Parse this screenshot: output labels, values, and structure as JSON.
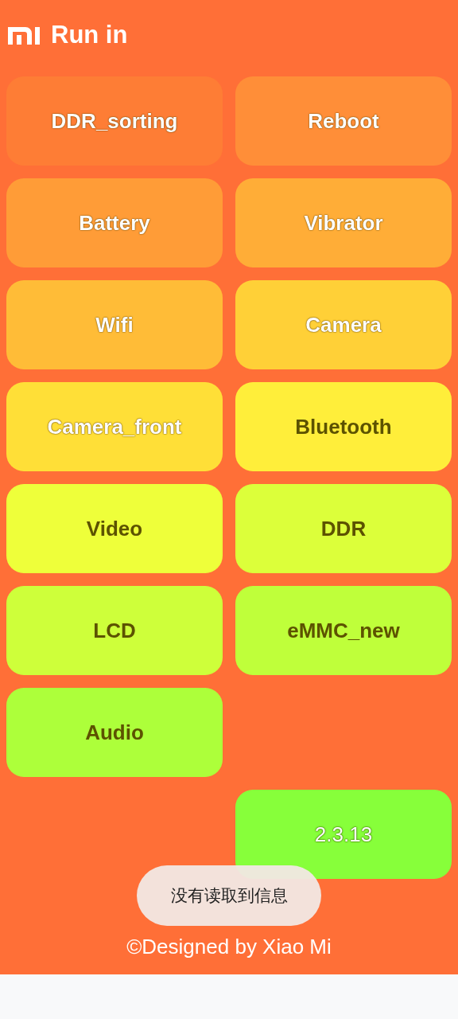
{
  "header": {
    "title": "Run in"
  },
  "buttons": [
    {
      "label": "DDR_sorting",
      "kind": "test",
      "color": "#fe7d35"
    },
    {
      "label": "Reboot",
      "kind": "test",
      "color": "#ff8e38"
    },
    {
      "label": "Battery",
      "kind": "test",
      "color": "#ff9c37"
    },
    {
      "label": "Vibrator",
      "kind": "test",
      "color": "#ffad37"
    },
    {
      "label": "Wifi",
      "kind": "test",
      "color": "#ffbc37"
    },
    {
      "label": "Camera",
      "kind": "test",
      "color": "#ffd037"
    },
    {
      "label": "Camera_front",
      "kind": "test",
      "color": "#ffdf37"
    },
    {
      "label": "Bluetooth",
      "kind": "test",
      "color": "#ffee3a"
    },
    {
      "label": "Video",
      "kind": "test",
      "color": "#eeff3a"
    },
    {
      "label": "DDR",
      "kind": "test",
      "color": "#dcff3a"
    },
    {
      "label": "LCD",
      "kind": "test",
      "color": "#ceff3a"
    },
    {
      "label": "eMMC_new",
      "kind": "test",
      "color": "#bfff3a"
    },
    {
      "label": "Audio",
      "kind": "test",
      "color": "#adff3a"
    },
    {
      "label": "2.3.13",
      "kind": "version",
      "color": "#87ff3a"
    }
  ],
  "footer": "©Designed by Xiao Mi",
  "toast": "没有读取到信息"
}
